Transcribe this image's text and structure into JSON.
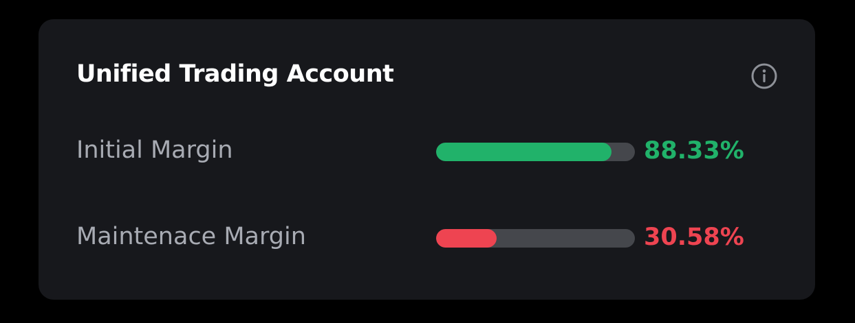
{
  "card": {
    "title": "Unified Trading Account",
    "info_icon": "info-circle-icon"
  },
  "rows": [
    {
      "label": "Initial Margin",
      "value_text": "88.33%",
      "fraction": 0.8833,
      "color": "#21b26a"
    },
    {
      "label": "Maintenace Margin",
      "value_text": "30.58%",
      "fraction": 0.3058,
      "color": "#ee4451"
    }
  ],
  "colors": {
    "track": "#45474c",
    "card_bg": "#17181c",
    "label": "#a8abb3"
  }
}
